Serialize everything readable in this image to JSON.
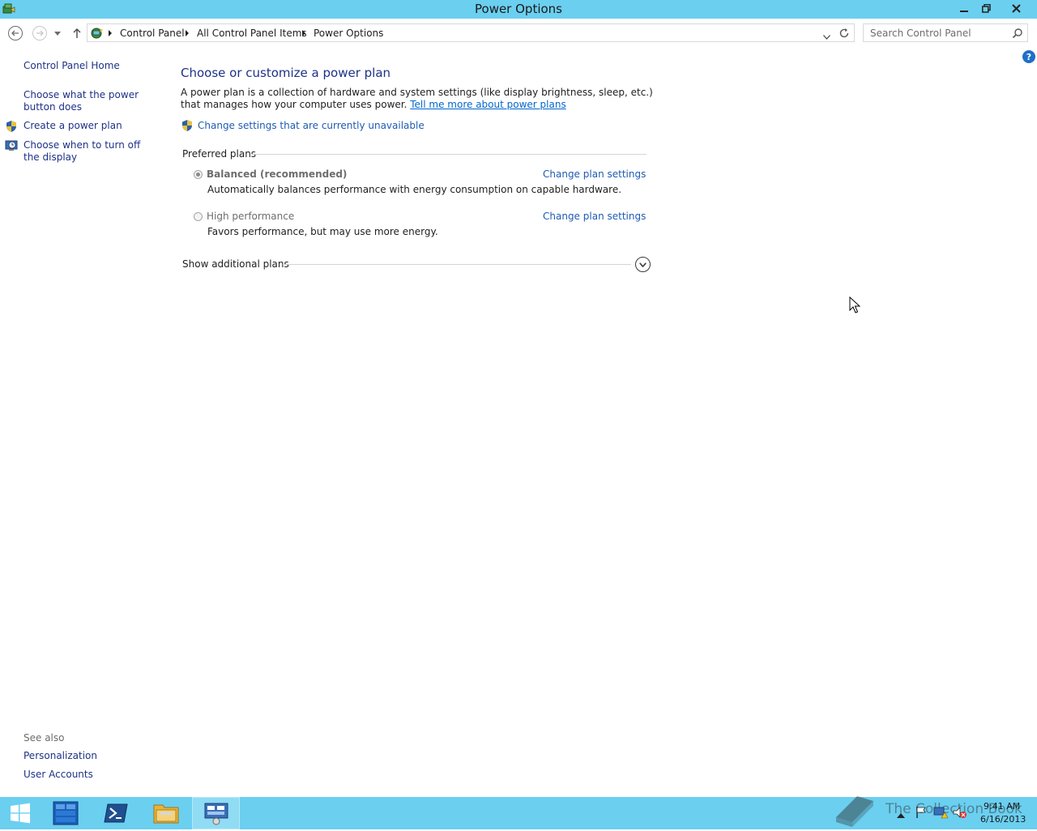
{
  "window": {
    "title": "Power Options"
  },
  "nav": {
    "breadcrumbs": [
      "Control Panel",
      "All Control Panel Items",
      "Power Options"
    ],
    "search_placeholder": "Search Control Panel"
  },
  "sidebar": {
    "home": "Control Panel Home",
    "links": [
      "Choose what the power button does",
      "Create a power plan",
      "Choose when to turn off the display"
    ],
    "see_also_label": "See also",
    "see_also": [
      "Personalization",
      "User Accounts"
    ]
  },
  "main": {
    "title": "Choose or customize a power plan",
    "description": "A power plan is a collection of hardware and system settings (like display brightness, sleep, etc.) that manages how your computer uses power.",
    "learn_more": "Tell me more about power plans",
    "change_unavailable": "Change settings that are currently unavailable",
    "group_label": "Preferred plans",
    "plans": [
      {
        "name": "Balanced (recommended)",
        "description": "Automatically balances performance with energy consumption on capable hardware.",
        "change_label": "Change plan settings",
        "selected": true
      },
      {
        "name": "High performance",
        "description": "Favors performance, but may use more energy.",
        "change_label": "Change plan settings",
        "selected": false
      }
    ],
    "show_additional": "Show additional plans"
  },
  "help_label": "?",
  "taskbar": {
    "time": "9:41 AM",
    "date": "6/16/2013",
    "watermark": "The Collection Book"
  },
  "colors": {
    "titlebar": "#6bcff0",
    "link": "#1e5bb3",
    "heading": "#1e3287"
  }
}
